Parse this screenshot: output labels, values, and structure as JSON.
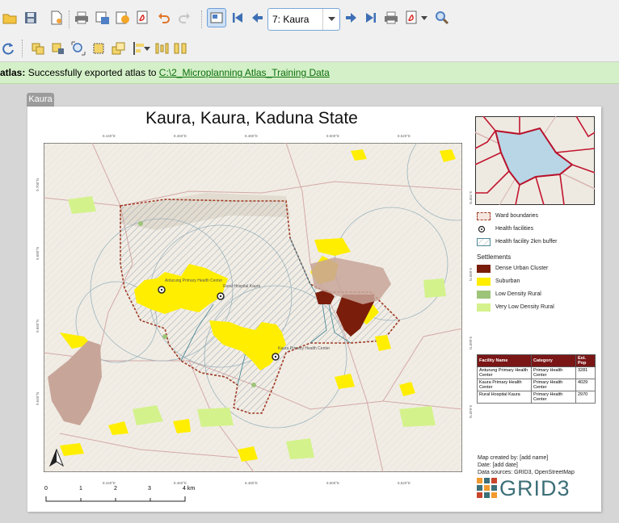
{
  "toolbar": {
    "atlas_feature_value": "7: Kaura"
  },
  "message_bar": {
    "prefix": "atlas:",
    "text": "Successfully exported atlas to",
    "link": "C:\\2_Microplanning Atlas_Training Data"
  },
  "layout_tab": "Kaura",
  "map": {
    "title": "Kaura, Kaura, Kaduna State",
    "x_ticks": [
      "8.440°E",
      "8.460°E",
      "8.480°E",
      "8.500°E",
      "8.520°E"
    ],
    "y_ticks": [
      "9.700°N",
      "9.680°N",
      "9.660°N",
      "9.640°N"
    ],
    "facilities": [
      {
        "name": "Anturung Primary Health Center"
      },
      {
        "name": "Kaura Primary Health Center"
      },
      {
        "name": "Rural Hospital Kaura"
      }
    ]
  },
  "legend": {
    "items": [
      {
        "label": "Ward boundaries",
        "icon": "dashed-red-box"
      },
      {
        "label": "Health facilities",
        "icon": "circle-dot"
      },
      {
        "label": "Health facility 2km buffer",
        "icon": "hatched-box"
      }
    ],
    "settlements_title": "Settlements",
    "settlements": [
      {
        "label": "Dense Urban Cluster",
        "color": "#7a1d0b"
      },
      {
        "label": "Suburban",
        "color": "#ffee00"
      },
      {
        "label": "Low Density Rural",
        "color": "#9ec47a"
      },
      {
        "label": "Very Low Density Rural",
        "color": "#d4f28c"
      }
    ]
  },
  "facility_table": {
    "headers": [
      "Facility Name",
      "Category",
      "Est. Pop"
    ],
    "rows": [
      [
        "Anturung Primary Health Center",
        "Primary Health Center",
        "3281"
      ],
      [
        "Kaura Primary Health Center",
        "Primary Health Center",
        "4029"
      ],
      [
        "Rural Hospital Kaura",
        "Primary Health Center",
        "2970"
      ]
    ]
  },
  "credits": {
    "created_by": "Map created by: [add name]",
    "date": "Date: [add date]",
    "sources": "Data sources: GRID3, OpenStreetMap"
  },
  "logo_text": "GRID3",
  "scale": {
    "labels": [
      "0",
      "1",
      "2",
      "3",
      "4 km"
    ]
  },
  "colors": {
    "message_bg": "#d4f0c8",
    "ward_boundary": "#a03a24",
    "table_header": "#7b1616",
    "logo": "#3d6f78"
  }
}
